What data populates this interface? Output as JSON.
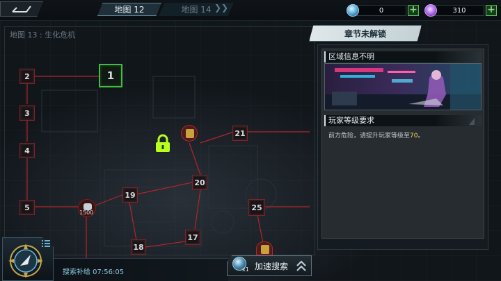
{
  "topbar": {
    "tabs": [
      {
        "label": "地图 12",
        "active": true
      },
      {
        "label": "地图 14",
        "active": false
      }
    ],
    "resources": [
      {
        "icon": "blue-orb-icon",
        "value": "0",
        "color": "#4aa3d6"
      },
      {
        "icon": "purple-gem-icon",
        "value": "310",
        "color": "#a860e6"
      }
    ]
  },
  "map": {
    "title": "地图 13 : 生化危机",
    "nodes": [
      "1",
      "2",
      "3",
      "4",
      "5",
      "17",
      "18",
      "19",
      "20",
      "21",
      "25"
    ],
    "badges": [
      "1500"
    ],
    "locked": true,
    "colors": {
      "link": "#b3242c",
      "current": "#3fbf3f",
      "lock": "#b8ff1c"
    }
  },
  "panel": {
    "header": "章节未解锁",
    "section_region": "区域信息不明",
    "section_requirement": "玩家等级要求",
    "desc_prefix": "前方危险，请提升玩家等级至",
    "required_level": "70",
    "desc_suffix": "。"
  },
  "bottom": {
    "timer_label": "搜索补给 07:56:05",
    "speed_label": "加速搜索",
    "speed_multiplier": "x1"
  }
}
